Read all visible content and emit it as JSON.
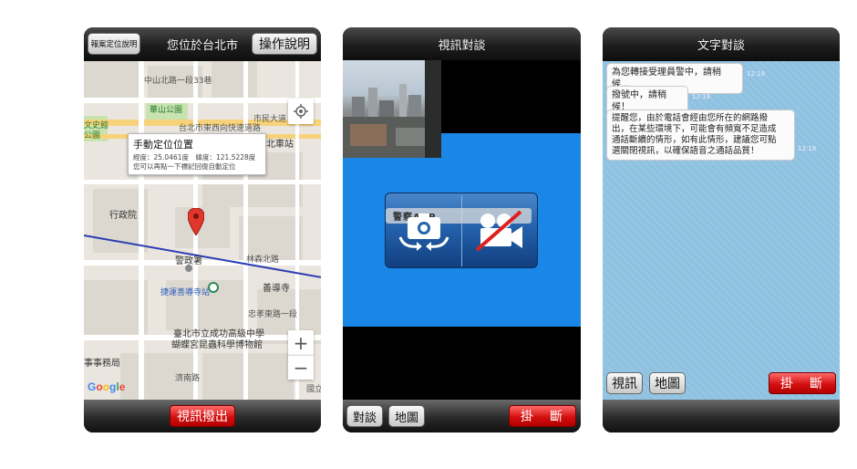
{
  "phone1": {
    "top_left_button": "報案定位說明",
    "title": "您位於台北市",
    "top_right_button": "操作說明",
    "map": {
      "labels": {
        "zhongshan_north": "中山北路一段33巷",
        "huashan_park": "華山公園",
        "civil_blvd": "市民大道",
        "zhongxiao_east": "台北市東西向快速道路",
        "culture_park": "文史館公園",
        "taipei_station": "北車站",
        "executive_yuan": "行政院",
        "npa": "警政署",
        "linsen_south": "林森北路",
        "mrt_station": "捷運善導寺站",
        "shandao_temple": "善導寺",
        "zhongxiao_sec1": "忠孝東路一段",
        "chenggong_school": "臺北市立成功高級中學",
        "insect_museum": "蝴蝶宮昆蟲科學博物館",
        "lawfirm": "事事務局",
        "jinan_road": "濟南路",
        "guoli": "國立"
      },
      "info_window": {
        "title": "手動定位位置",
        "coords": "經度：25.0461度　緯度：121.5228度",
        "hint": "您可以再點一下標記回復自動定位"
      },
      "zoom_in": "+",
      "zoom_out": "−",
      "logo": "Google"
    },
    "bottom_button": "視訊撥出",
    "icons": [
      "locate-icon",
      "map-pin-icon",
      "metro-icon",
      "temple-icon"
    ]
  },
  "phone2": {
    "title": "視訊對談",
    "overlay_text": "警察APP",
    "bottom_left_1": "對談",
    "bottom_left_2": "地圖",
    "hangup": "掛　斷",
    "icons": [
      "switch-camera-icon",
      "video-off-icon"
    ]
  },
  "phone3": {
    "title": "文字對談",
    "messages": [
      {
        "text": "為您轉接受理員警中，請稍候...",
        "time": "12:18"
      },
      {
        "text": "撥號中，請稍候！",
        "time": "12:18"
      },
      {
        "text_lines": [
          "提醒您，由於電話會經由您所在的網路撥",
          "出，在某些環境下，可能會有頻寬不足造成",
          "通話斷續的情形，如有此情形，建議您可點",
          "選關閉視訊，以確保語音之通話品質！"
        ],
        "time": "12:18"
      }
    ],
    "button_video": "視訊",
    "button_map": "地圖",
    "hangup": "掛　斷"
  },
  "colors": {
    "accent_red": "#d40f0f",
    "map_blue": "#2d3cb5",
    "video_blue": "#1a87e6",
    "chat_bg": "#94c5e3"
  }
}
